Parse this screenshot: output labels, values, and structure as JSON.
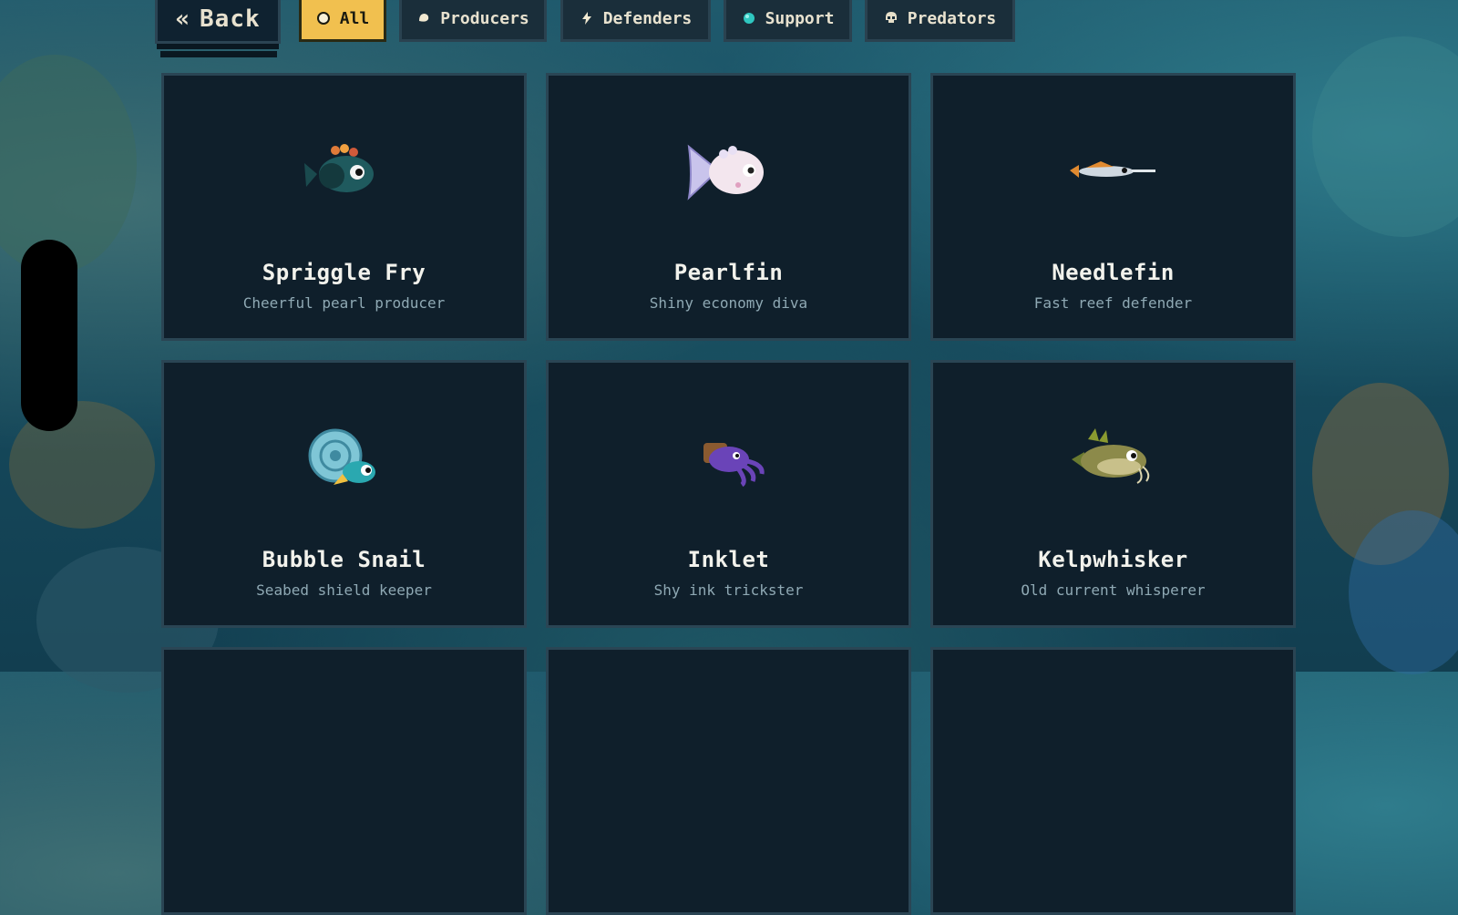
{
  "nav": {
    "back_label": "Back",
    "back_icon": "double-chevron-left-icon"
  },
  "filters": [
    {
      "label": "All",
      "icon": "shell-icon",
      "active": true
    },
    {
      "label": "Producers",
      "icon": "pearl-shell-icon",
      "active": false
    },
    {
      "label": "Defenders",
      "icon": "lightning-icon",
      "active": false
    },
    {
      "label": "Support",
      "icon": "bubble-icon",
      "active": false
    },
    {
      "label": "Predators",
      "icon": "skull-icon",
      "active": false
    }
  ],
  "creatures": [
    {
      "name": "Spriggle Fry",
      "description": "Cheerful pearl producer",
      "sprite": "spiky-fish-sprite"
    },
    {
      "name": "Pearlfin",
      "description": "Shiny economy diva",
      "sprite": "pearl-fish-sprite"
    },
    {
      "name": "Needlefin",
      "description": "Fast reef defender",
      "sprite": "needle-fish-sprite"
    },
    {
      "name": "Bubble Snail",
      "description": "Seabed shield keeper",
      "sprite": "snail-fish-sprite"
    },
    {
      "name": "Inklet",
      "description": "Shy ink trickster",
      "sprite": "squid-sprite"
    },
    {
      "name": "Kelpwhisker",
      "description": "Old current whisperer",
      "sprite": "catfish-sprite"
    }
  ],
  "colors": {
    "accent": "#f1c04f",
    "card_bg": "#0f1f2b",
    "card_border": "#2a4554",
    "text": "#f2f2ec",
    "muted": "#8fa9b4"
  }
}
